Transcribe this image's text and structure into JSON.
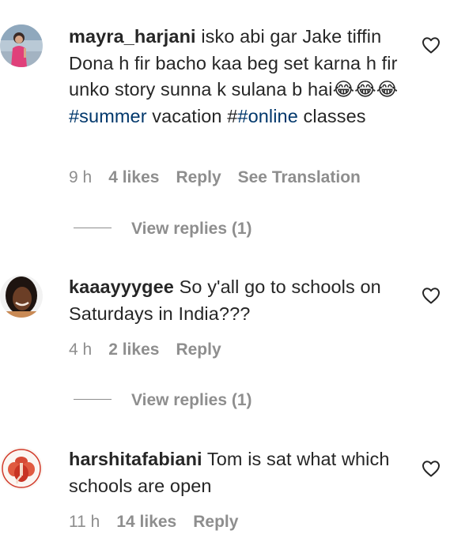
{
  "colors": {
    "text": "#262626",
    "secondary": "#8e8e8e",
    "hashtag": "#00376b"
  },
  "comments": [
    {
      "username": "mayra_harjani",
      "text_before": "isko abi gar Jake tiffin Dona h fir bacho kaa beg set karna h fir unko story sunna k sulana b hai😂😂😂",
      "hashtag1": "#summer",
      "text_mid": " vacation #",
      "hashtag2": "#online",
      "text_after": " classes",
      "time": "9 h",
      "likes": "4 likes",
      "reply": "Reply",
      "translation": "See Translation",
      "view_replies": "View replies (1)",
      "like_icon": "heart-outline-icon"
    },
    {
      "username": "kaaayyygee",
      "text": "So y'all go to schools on Saturdays in India???",
      "time": "4 h",
      "likes": "2 likes",
      "reply": "Reply",
      "view_replies": "View replies (1)",
      "like_icon": "heart-outline-icon"
    },
    {
      "username": "harshitafabiani",
      "text": "Tom is sat what which schools are open",
      "time": "11 h",
      "likes": "14 likes",
      "reply": "Reply",
      "like_icon": "heart-outline-icon"
    }
  ]
}
